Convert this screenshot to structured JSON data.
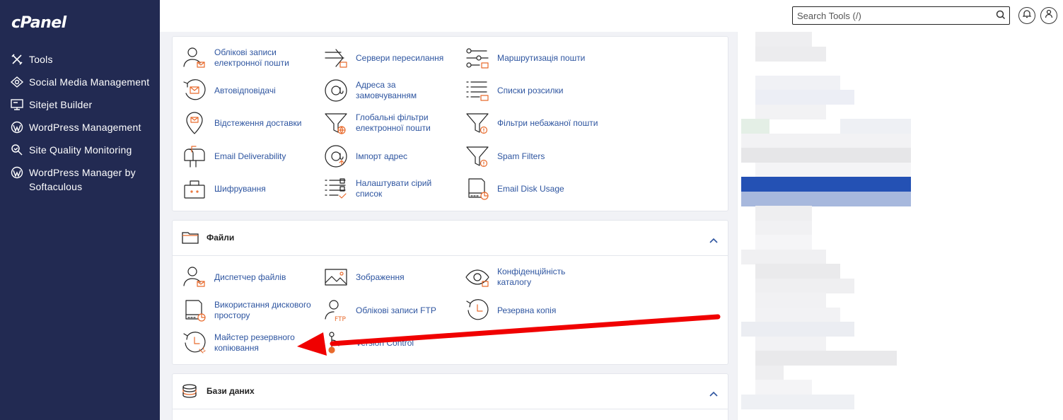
{
  "brand": {
    "logo_text": "cPanel"
  },
  "sidebar": {
    "items": [
      {
        "label": "Tools",
        "icon": "tools-icon"
      },
      {
        "label": "Social Media Management",
        "icon": "social-media-icon"
      },
      {
        "label": "Sitejet Builder",
        "icon": "sitejet-icon"
      },
      {
        "label": "WordPress Management",
        "icon": "wordpress-icon"
      },
      {
        "label": "Site Quality Monitoring",
        "icon": "site-quality-icon"
      },
      {
        "label": "WordPress Manager by Softaculous",
        "icon": "wordpress-icon"
      }
    ]
  },
  "header": {
    "search_placeholder": "Search Tools (/)",
    "icons": [
      "search-icon",
      "bell-icon",
      "user-icon"
    ]
  },
  "email_section": {
    "tools": [
      {
        "label": "Облікові записи електронної пошти",
        "icon": "email-accounts-icon"
      },
      {
        "label": "Сервери пересилання",
        "icon": "forwarders-icon"
      },
      {
        "label": "Маршрутизація пошти",
        "icon": "email-routing-icon"
      },
      {
        "label": "Автовідповідачі",
        "icon": "autoresponders-icon"
      },
      {
        "label": "Адреса за замовчуванням",
        "icon": "default-address-icon"
      },
      {
        "label": "Списки розсилки",
        "icon": "mailing-lists-icon"
      },
      {
        "label": "Відстеження доставки",
        "icon": "track-delivery-icon"
      },
      {
        "label": "Глобальні фільтри електронної пошти",
        "icon": "global-filters-icon"
      },
      {
        "label": "Фільтри небажаної пошти",
        "icon": "spam-filters-icon"
      },
      {
        "label": "Email Deliverability",
        "icon": "mailbox-icon"
      },
      {
        "label": "Імпорт адрес",
        "icon": "import-addresses-icon"
      },
      {
        "label": "Spam Filters",
        "icon": "spam-filters-icon"
      },
      {
        "label": "Шифрування",
        "icon": "encryption-icon"
      },
      {
        "label": "Налаштувати сірий список",
        "icon": "greylisting-icon"
      },
      {
        "label": "Email Disk Usage",
        "icon": "disk-usage-icon"
      }
    ]
  },
  "files_section": {
    "title": "Файли",
    "tools": [
      {
        "label": "Диспетчер файлів",
        "icon": "file-manager-icon"
      },
      {
        "label": "Зображення",
        "icon": "images-icon"
      },
      {
        "label": "Конфіденційність каталогу",
        "icon": "directory-privacy-icon"
      },
      {
        "label": "Використання дискового простору",
        "icon": "disk-usage-icon"
      },
      {
        "label": "Облікові записи FTP",
        "icon": "ftp-accounts-icon"
      },
      {
        "label": "Резервна копія",
        "icon": "backup-icon"
      },
      {
        "label": "Майстер резервного копіювання",
        "icon": "backup-wizard-icon"
      },
      {
        "label": "Version Control",
        "icon": "version-control-icon"
      }
    ]
  },
  "databases_section": {
    "title": "Бази даних"
  },
  "colors": {
    "sidebar_bg": "#222a52",
    "link": "#2e55a0",
    "icon_accent": "#e86a2c",
    "annotation_arrow": "#f00000"
  }
}
